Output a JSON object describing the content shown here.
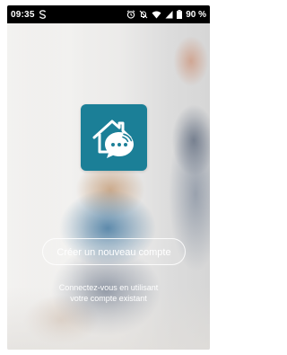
{
  "status_bar": {
    "time": "09:35",
    "notification_icon": "s-notification-icon",
    "alarm_icon": "alarm-icon",
    "mute_icon": "mute-icon",
    "wifi_icon": "wifi-icon",
    "signal_icon": "signal-icon",
    "battery_icon": "battery-icon",
    "battery_percent": "90 %"
  },
  "app": {
    "logo_icon": "smart-home-logo-icon",
    "brand_color": "#1b7f97"
  },
  "actions": {
    "create_account": "Créer un nouveau compte",
    "login_line1": "Connectez-vous en utilisant",
    "login_line2": "votre compte existant"
  }
}
